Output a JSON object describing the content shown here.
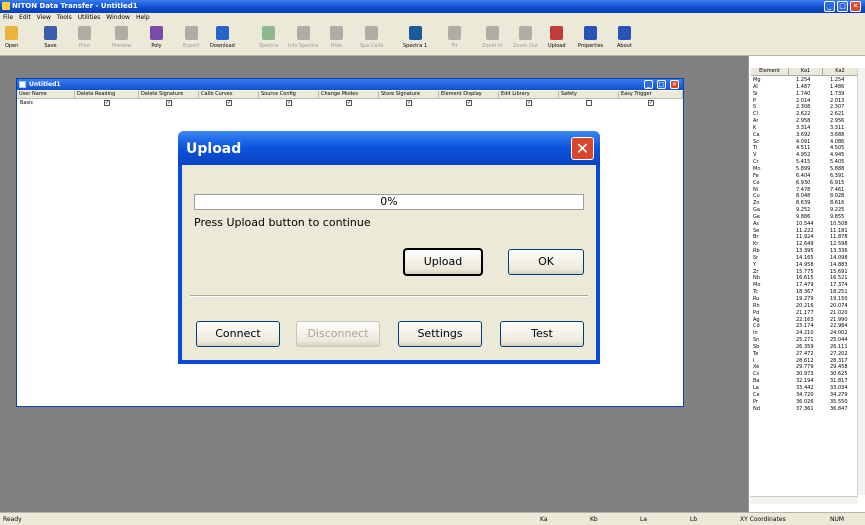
{
  "window": {
    "title": "NITON Data Transfer - Untitled1"
  },
  "menu": [
    "File",
    "Edit",
    "View",
    "Tools",
    "Utilities",
    "Window",
    "Help"
  ],
  "toolbar": [
    {
      "label": "Open",
      "enabled": true,
      "icon": "open-folder-icon",
      "color": "#e8b43c"
    },
    {
      "label": "Save",
      "enabled": true,
      "icon": "save-disk-icon",
      "color": "#3a5fa8"
    },
    {
      "label": "Print",
      "enabled": false,
      "icon": "printer-icon",
      "color": "#666666"
    },
    {
      "label": "Preview",
      "enabled": false,
      "icon": "print-preview-icon",
      "color": "#666666"
    },
    {
      "label": "Poly",
      "enabled": true,
      "icon": "poly-fx-icon",
      "color": "#7a4aa8"
    },
    {
      "label": "Export",
      "enabled": false,
      "icon": "export-icon",
      "color": "#666666"
    },
    {
      "label": "Download",
      "enabled": true,
      "icon": "download-icon",
      "color": "#2a63c8"
    },
    {
      "label": "Spectra",
      "enabled": false,
      "icon": "spectra-icon",
      "color": "#1c7a38"
    },
    {
      "label": "Info Spectra",
      "enabled": false,
      "icon": "info-spectra-icon",
      "color": "#666666"
    },
    {
      "label": "Hide",
      "enabled": false,
      "icon": "hide-icon",
      "color": "#666666"
    },
    {
      "label": "Spe Calib",
      "enabled": false,
      "icon": "spectra-calib-icon",
      "color": "#666666"
    },
    {
      "label": "Spectra 1",
      "enabled": true,
      "icon": "spectra-bars-icon",
      "color": "#1c5a9c"
    },
    {
      "label": "Fit",
      "enabled": false,
      "icon": "fit-icon",
      "color": "#666666"
    },
    {
      "label": "Zoom In",
      "enabled": false,
      "icon": "zoom-in-icon",
      "color": "#666666"
    },
    {
      "label": "Zoom Out",
      "enabled": false,
      "icon": "zoom-out-icon",
      "color": "#666666"
    },
    {
      "label": "Upload",
      "enabled": true,
      "icon": "upload-icon",
      "color": "#c23a3a"
    },
    {
      "label": "Properties",
      "enabled": true,
      "icon": "properties-icon",
      "color": "#2a53b8"
    },
    {
      "label": "About",
      "enabled": true,
      "icon": "about-question-icon",
      "color": "#2a53b8"
    }
  ],
  "child_window": {
    "title": "Untitled1",
    "columns": [
      "User Name",
      "Delete Reading",
      "Delete Signature",
      "Calib Curves",
      "Source Config",
      "Change Modes",
      "Store Signature",
      "Element Display",
      "Edit Library",
      "Safety",
      "Easy Trigger"
    ],
    "row": {
      "user": "Basic",
      "checks": [
        true,
        true,
        true,
        true,
        true,
        true,
        true,
        true,
        false,
        true
      ]
    }
  },
  "dialog": {
    "title": "Upload",
    "progress_percent": 0,
    "progress_text": "0%",
    "status": "Press Upload button to continue",
    "buttons": {
      "upload": "Upload",
      "ok": "OK",
      "connect": "Connect",
      "disconnect": "Disconnect",
      "settings": "Settings",
      "test": "Test"
    }
  },
  "element_table": {
    "headers": [
      "Element",
      "Ka1",
      "Ka2"
    ],
    "rows": [
      [
        "Mg",
        "1.254",
        "1.254"
      ],
      [
        "Al",
        "1.487",
        "1.486"
      ],
      [
        "Si",
        "1.740",
        "1.739"
      ],
      [
        "P",
        "2.014",
        "2.013"
      ],
      [
        "S",
        "2.308",
        "2.307"
      ],
      [
        "Cl",
        "2.622",
        "2.621"
      ],
      [
        "Ar",
        "2.958",
        "2.956"
      ],
      [
        "K",
        "3.314",
        "3.311"
      ],
      [
        "Ca",
        "3.692",
        "3.688"
      ],
      [
        "Sc",
        "4.091",
        "4.086"
      ],
      [
        "Ti",
        "4.511",
        "4.505"
      ],
      [
        "V",
        "4.952",
        "4.945"
      ],
      [
        "Cr",
        "5.415",
        "5.405"
      ],
      [
        "Mn",
        "5.899",
        "5.888"
      ],
      [
        "Fe",
        "6.404",
        "6.391"
      ],
      [
        "Co",
        "6.930",
        "6.915"
      ],
      [
        "Ni",
        "7.478",
        "7.461"
      ],
      [
        "Cu",
        "8.048",
        "8.028"
      ],
      [
        "Zn",
        "8.639",
        "8.616"
      ],
      [
        "Ga",
        "9.252",
        "9.225"
      ],
      [
        "Ge",
        "9.886",
        "9.855"
      ],
      [
        "As",
        "10.544",
        "10.508"
      ],
      [
        "Se",
        "11.222",
        "11.181"
      ],
      [
        "Br",
        "11.924",
        "11.878"
      ],
      [
        "Kr",
        "12.649",
        "12.598"
      ],
      [
        "Rb",
        "13.395",
        "13.336"
      ],
      [
        "Sr",
        "14.165",
        "14.098"
      ],
      [
        "Y",
        "14.958",
        "14.883"
      ],
      [
        "Zr",
        "15.775",
        "15.691"
      ],
      [
        "Nb",
        "16.615",
        "16.521"
      ],
      [
        "Mo",
        "17.479",
        "17.374"
      ],
      [
        "Tc",
        "18.367",
        "18.251"
      ],
      [
        "Ru",
        "19.279",
        "19.150"
      ],
      [
        "Rh",
        "20.216",
        "20.074"
      ],
      [
        "Pd",
        "21.177",
        "21.020"
      ],
      [
        "Ag",
        "22.163",
        "21.990"
      ],
      [
        "Cd",
        "23.174",
        "22.984"
      ],
      [
        "In",
        "24.210",
        "24.002"
      ],
      [
        "Sn",
        "25.271",
        "25.044"
      ],
      [
        "Sb",
        "26.359",
        "26.111"
      ],
      [
        "Te",
        "27.472",
        "27.202"
      ],
      [
        "I",
        "28.612",
        "28.317"
      ],
      [
        "Xe",
        "29.779",
        "29.458"
      ],
      [
        "Cs",
        "30.973",
        "30.625"
      ],
      [
        "Ba",
        "32.194",
        "31.817"
      ],
      [
        "La",
        "33.442",
        "33.034"
      ],
      [
        "Ce",
        "34.720",
        "34.279"
      ],
      [
        "Pr",
        "36.026",
        "35.550"
      ],
      [
        "Nd",
        "37.361",
        "36.847"
      ]
    ]
  },
  "statusbar": {
    "ready": "Ready",
    "ka": "Ka",
    "kb": "Kb",
    "la": "La",
    "lb": "Lb",
    "coords": "XY Coordinates",
    "num": "NUM"
  }
}
